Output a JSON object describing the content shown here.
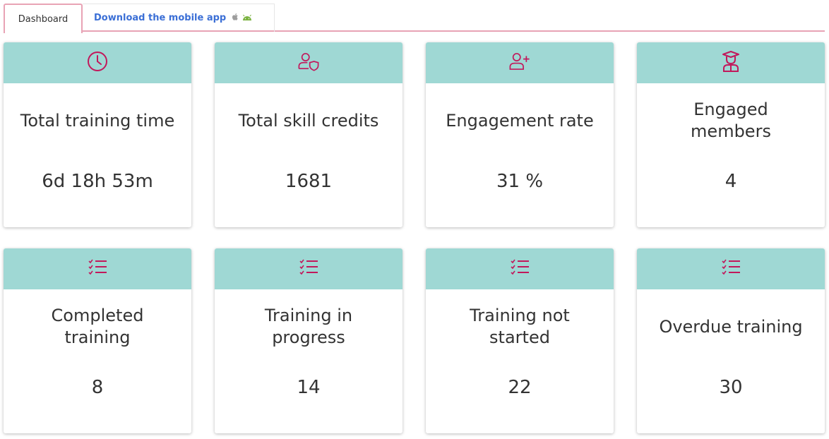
{
  "tabs": {
    "dashboard_label": "Dashboard",
    "mobile_label": "Download the mobile app"
  },
  "icons": {
    "accent": "#c2185b",
    "header_bg": "#9fd8d4"
  },
  "cards": [
    {
      "icon": "clock-icon",
      "title": "Total training time",
      "value": "6d 18h 53m"
    },
    {
      "icon": "user-shield-icon",
      "title": "Total skill credits",
      "value": "1681"
    },
    {
      "icon": "user-plus-icon",
      "title": "Engagement rate",
      "value": "31 %"
    },
    {
      "icon": "graduate-icon",
      "title": "Engaged members",
      "value": "4"
    },
    {
      "icon": "checklist-icon",
      "title": "Completed training",
      "value": "8"
    },
    {
      "icon": "checklist-icon",
      "title": "Training in progress",
      "value": "14"
    },
    {
      "icon": "checklist-icon",
      "title": "Training not started",
      "value": "22"
    },
    {
      "icon": "checklist-icon",
      "title": "Overdue training",
      "value": "30"
    }
  ]
}
